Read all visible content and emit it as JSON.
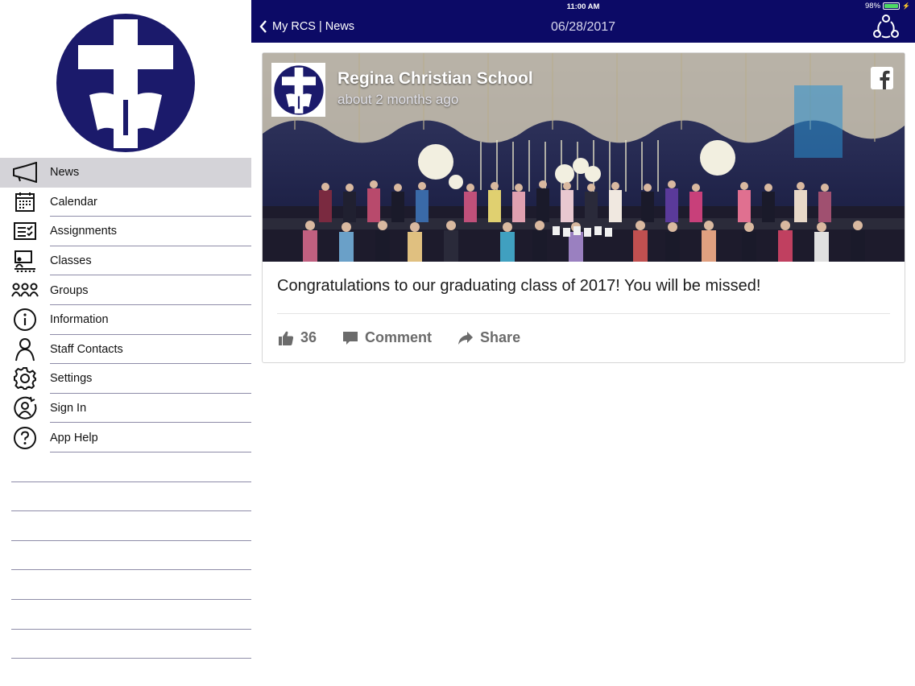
{
  "status_bar": {
    "time": "11:00 AM",
    "battery": "98%"
  },
  "nav": {
    "back_label": "My RCS | News",
    "date": "06/28/2017"
  },
  "sidebar": {
    "items": [
      {
        "label": "News",
        "icon": "megaphone-icon",
        "active": true
      },
      {
        "label": "Calendar",
        "icon": "calendar-icon",
        "active": false
      },
      {
        "label": "Assignments",
        "icon": "assignments-icon",
        "active": false
      },
      {
        "label": "Classes",
        "icon": "classes-icon",
        "active": false
      },
      {
        "label": "Groups",
        "icon": "groups-icon",
        "active": false
      },
      {
        "label": "Information",
        "icon": "info-icon",
        "active": false
      },
      {
        "label": "Staff Contacts",
        "icon": "person-icon",
        "active": false
      },
      {
        "label": "Settings",
        "icon": "gear-icon",
        "active": false
      },
      {
        "label": "Sign In",
        "icon": "sign-in-icon",
        "active": false
      },
      {
        "label": "App Help",
        "icon": "help-icon",
        "active": false
      }
    ]
  },
  "post": {
    "org_name": "Regina Christian School",
    "age": "about 2 months ago",
    "text": "Congratulations to our graduating class of 2017! You will be missed!",
    "likes": "36",
    "comment_label": "Comment",
    "share_label": "Share"
  },
  "colors": {
    "nav_bg": "#0c0a66",
    "logo_blue": "#1b1a6b",
    "active_item_bg": "#d4d3d8"
  }
}
